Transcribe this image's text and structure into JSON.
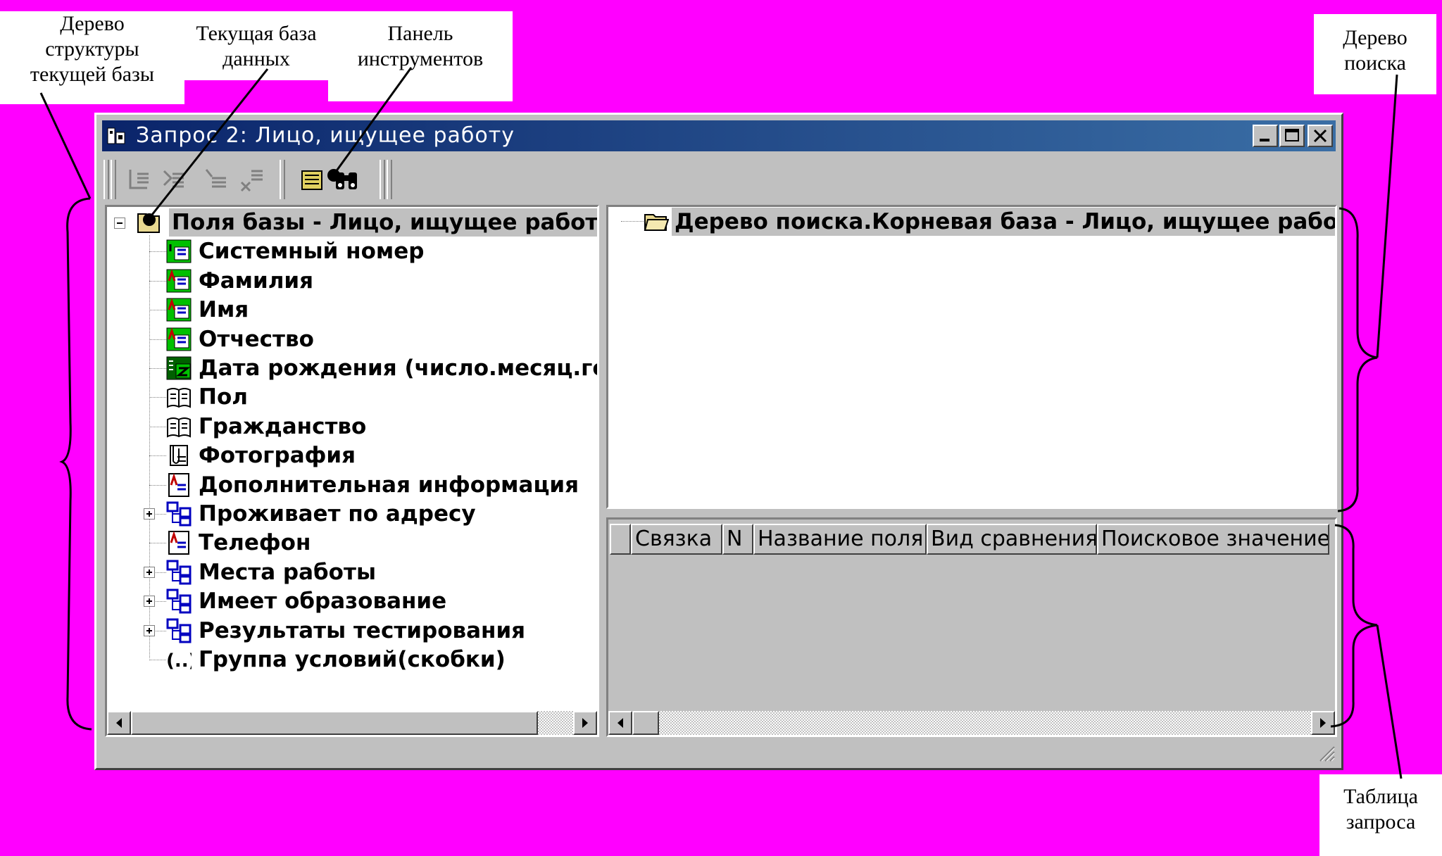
{
  "callouts": {
    "tree_current": [
      "Дерево",
      "структуры",
      "текущей базы"
    ],
    "current_db": [
      "Текущая база",
      "данных"
    ],
    "toolbar": [
      "Панель",
      "инструментов"
    ],
    "search_tree": [
      "Дерево",
      "поиска"
    ],
    "query_table": [
      "Таблица",
      "запроса"
    ]
  },
  "window": {
    "title": "Запрос 2: Лицо, ищущее работу"
  },
  "left_tree": {
    "root": "Поля базы - Лицо, ищущее работу",
    "items": [
      {
        "label": "Системный номер",
        "icon": "number-field-icon",
        "expandable": false
      },
      {
        "label": "Фамилия",
        "icon": "text-field-icon",
        "expandable": false
      },
      {
        "label": "Имя",
        "icon": "text-field-icon",
        "expandable": false
      },
      {
        "label": "Отчество",
        "icon": "text-field-icon",
        "expandable": false
      },
      {
        "label": "Дата рождения (число.месяц.го",
        "icon": "date-field-icon",
        "expandable": false
      },
      {
        "label": "Пол",
        "icon": "dictionary-field-icon",
        "expandable": false
      },
      {
        "label": "Гражданство",
        "icon": "dictionary-field-icon",
        "expandable": false
      },
      {
        "label": "Фотография",
        "icon": "image-field-icon",
        "expandable": false
      },
      {
        "label": "Дополнительная информация",
        "icon": "memo-field-icon",
        "expandable": false
      },
      {
        "label": "Проживает по адресу",
        "icon": "link-table-icon",
        "expandable": true
      },
      {
        "label": "Телефон",
        "icon": "memo-field-icon",
        "expandable": false
      },
      {
        "label": "Места работы",
        "icon": "link-table-icon",
        "expandable": true
      },
      {
        "label": "Имеет образование",
        "icon": "link-table-icon",
        "expandable": true
      },
      {
        "label": "Результаты тестирования",
        "icon": "link-table-icon",
        "expandable": true
      },
      {
        "label": "Группа условий(скобки)",
        "icon": "brackets-icon",
        "expandable": false
      }
    ]
  },
  "search_tree": {
    "root": "Дерево поиска.Корневая база - Лицо, ищущее работу"
  },
  "query_table": {
    "columns": [
      "Связка",
      "N",
      "Название поля",
      "Вид сравнения",
      "Поисковое значение"
    ]
  },
  "colors": {
    "background": "#ff00ff",
    "titlebar_start": "#0a246a",
    "titlebar_end": "#3a6ea5",
    "window_face": "#c0c0c0"
  }
}
